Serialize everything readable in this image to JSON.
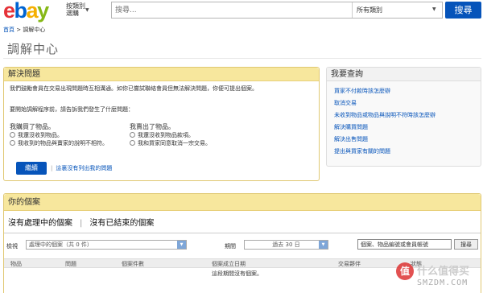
{
  "header": {
    "logo": {
      "e": "e",
      "b": "b",
      "a": "a",
      "y": "y"
    },
    "shop_by_category": "按類別\n選購",
    "search_placeholder": "搜尋...",
    "category_select": "所有類別",
    "search_button": "搜尋"
  },
  "breadcrumb": {
    "home": "首頁",
    "separator": " > ",
    "current": "調解中心"
  },
  "page_title": "調解中心",
  "solve_panel": {
    "title": "解決問題",
    "intro": "我們鼓勵會員在交易出現問題時互相溝通。如你已嘗試聯絡會員但無法解決問題，你便可提出個案。",
    "ask": "要開始調解程序前，請告訴我們發生了什麼問題：",
    "bought": {
      "title": "我購買了物品。",
      "options": [
        "我還沒收到物品。",
        "我收到的物品與賣家的說明不相符。"
      ]
    },
    "sold": {
      "title": "我賣出了物品。",
      "options": [
        "我還沒收到物品款項。",
        "我和買家同意取消一宗交易。"
      ]
    },
    "continue_button": "繼續",
    "not_listed_link": "這裏沒有列出我的問題"
  },
  "query_panel": {
    "title": "我要查詢",
    "links": [
      "買家不付款時該怎麼辦",
      "取消交易",
      "未收到物品或物品與說明不符時該怎麼辦",
      "解決購買問題",
      "解決出售問題",
      "提出與買家有關的問題"
    ]
  },
  "cases_panel": {
    "title": "你的個案",
    "tabs": [
      "沒有處理中的個案",
      "沒有已結束的個案"
    ],
    "view_label": "檢視",
    "view_select": "處理中的個案（共 0 件）",
    "period_label": "期間",
    "period_select": "過去 30 日",
    "case_search_value": "個案、物品編號或會員帳號",
    "case_search_button": "搜尋",
    "columns": [
      "物品",
      "問題",
      "個案件數",
      "個案成立日期",
      "交易夥伴",
      "狀態"
    ],
    "empty_message": "這段期間沒有個案。"
  },
  "watermark": {
    "icon": "值",
    "text": "什么值得买",
    "sub": "SMZDM.COM"
  }
}
